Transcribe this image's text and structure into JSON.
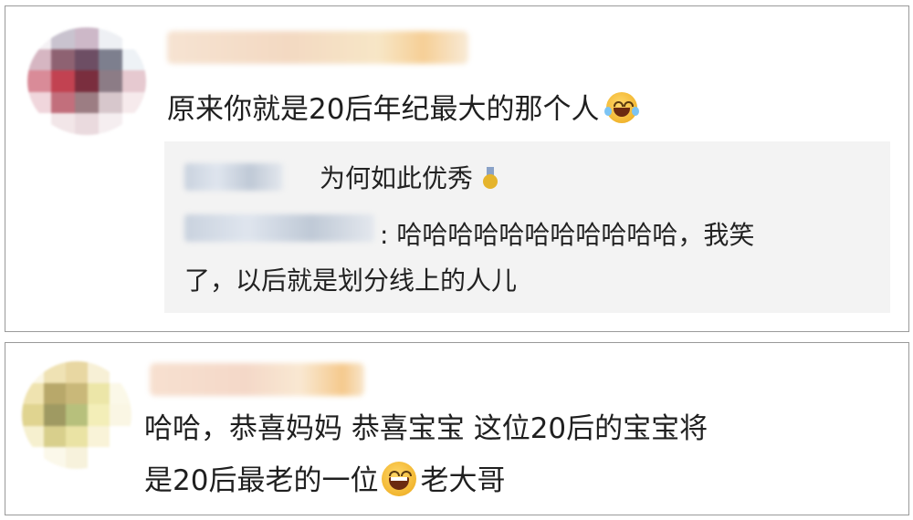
{
  "comments": [
    {
      "text": "原来你就是20后年纪最大的那个人",
      "emoji": "laughing-crying-emoji",
      "replies": [
        {
          "text": "为何如此优秀",
          "emoji": "medal-icon"
        },
        {
          "text_line1": ": 哈哈哈哈哈哈哈哈哈哈哈，我笑",
          "text_line2": "了，以后就是划分线上的人儿"
        }
      ]
    },
    {
      "text_line1": "哈哈，恭喜妈妈  恭喜宝宝   这位20后的宝宝将",
      "text_line2_before": "是20后最老的一位",
      "emoji": "big-laugh-emoji",
      "text_line2_after": "老大哥"
    }
  ],
  "colors": {
    "border": "#9a9a9a",
    "reply_background": "#f3f3f3",
    "text": "#1f1f1f"
  }
}
